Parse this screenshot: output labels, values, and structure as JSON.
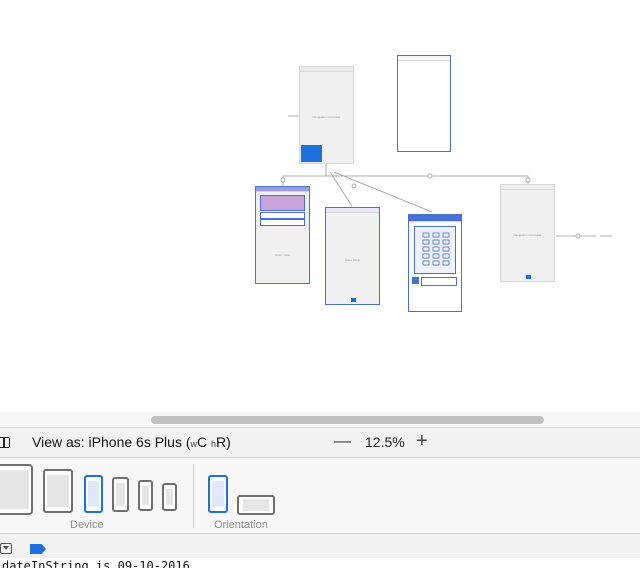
{
  "canvas": {
    "scenes": [
      {
        "id": "nav-controller",
        "label": "Navigation Controller"
      },
      {
        "id": "blank-scene",
        "label": ""
      },
      {
        "id": "purple-scene",
        "label": "Static Cells"
      },
      {
        "id": "table-scene",
        "label": "Static Table"
      },
      {
        "id": "grid-scene",
        "label": ""
      },
      {
        "id": "right-scene",
        "label": "Navigation Controller"
      }
    ]
  },
  "viewbar": {
    "view_as_label": "View as: iPhone 6s Plus",
    "size_class_open": " (",
    "size_w_prefix": "w",
    "size_w": "C",
    "size_h_prefix": "h",
    "size_h": "R",
    "size_class_close": ")",
    "zoom_out": "—",
    "zoom_level": "12.5%",
    "zoom_in": "+"
  },
  "device_bar": {
    "device_label": "Device",
    "orientation_label": "Orientation",
    "selected_device": "iPhone 6s Plus",
    "selected_orientation": "portrait"
  },
  "console": {
    "text": "dateInString is 09-10-2016"
  },
  "colors": {
    "accent": "#1f6fe0",
    "selection": "#4a6fd6",
    "scene_bg": "#f0f0f0"
  }
}
